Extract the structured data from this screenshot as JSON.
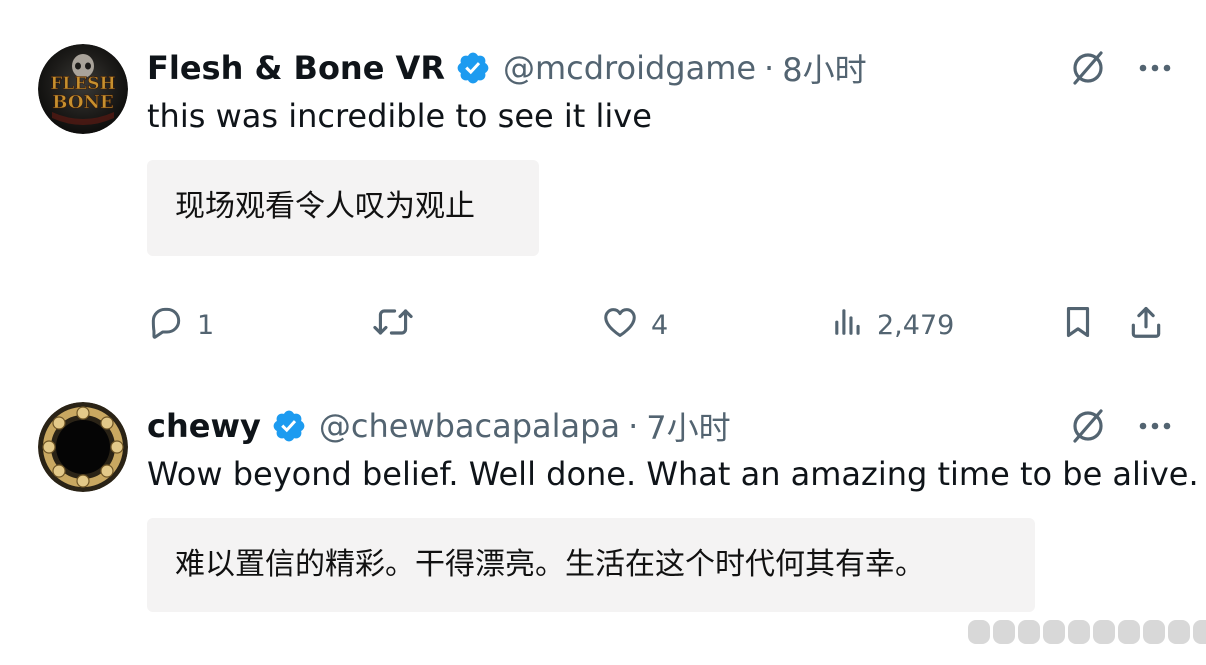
{
  "posts": [
    {
      "display_name": "Flesh & Bone VR",
      "handle": "@mcdroidgame",
      "separator": "·",
      "time": "8小时",
      "text": "this was incredible to see it live",
      "translation": "现场观看令人叹为观止",
      "avatar_text": [
        "FLESH",
        "BONE"
      ],
      "stats": {
        "replies": "1",
        "likes": "4",
        "views": "2,479"
      }
    },
    {
      "display_name": "chewy",
      "handle": "@chewbacapalapa",
      "separator": "·",
      "time": "7小时",
      "text": "Wow beyond belief. Well done. What an amazing time to be alive.",
      "translation": "难以置信的精彩。干得漂亮。生活在这个时代何其有幸。"
    }
  ],
  "colors": {
    "text": "#0f1419",
    "secondary": "#536471",
    "verified": "#1d9bf0",
    "translation_bg": "#f4f3f3"
  },
  "icons": {
    "verified": "verified-badge-icon",
    "grok": "grok-icon",
    "more": "more-icon",
    "reply": "reply-icon",
    "repost": "repost-icon",
    "like": "like-icon",
    "views": "views-icon",
    "bookmark": "bookmark-icon",
    "share": "share-icon"
  }
}
